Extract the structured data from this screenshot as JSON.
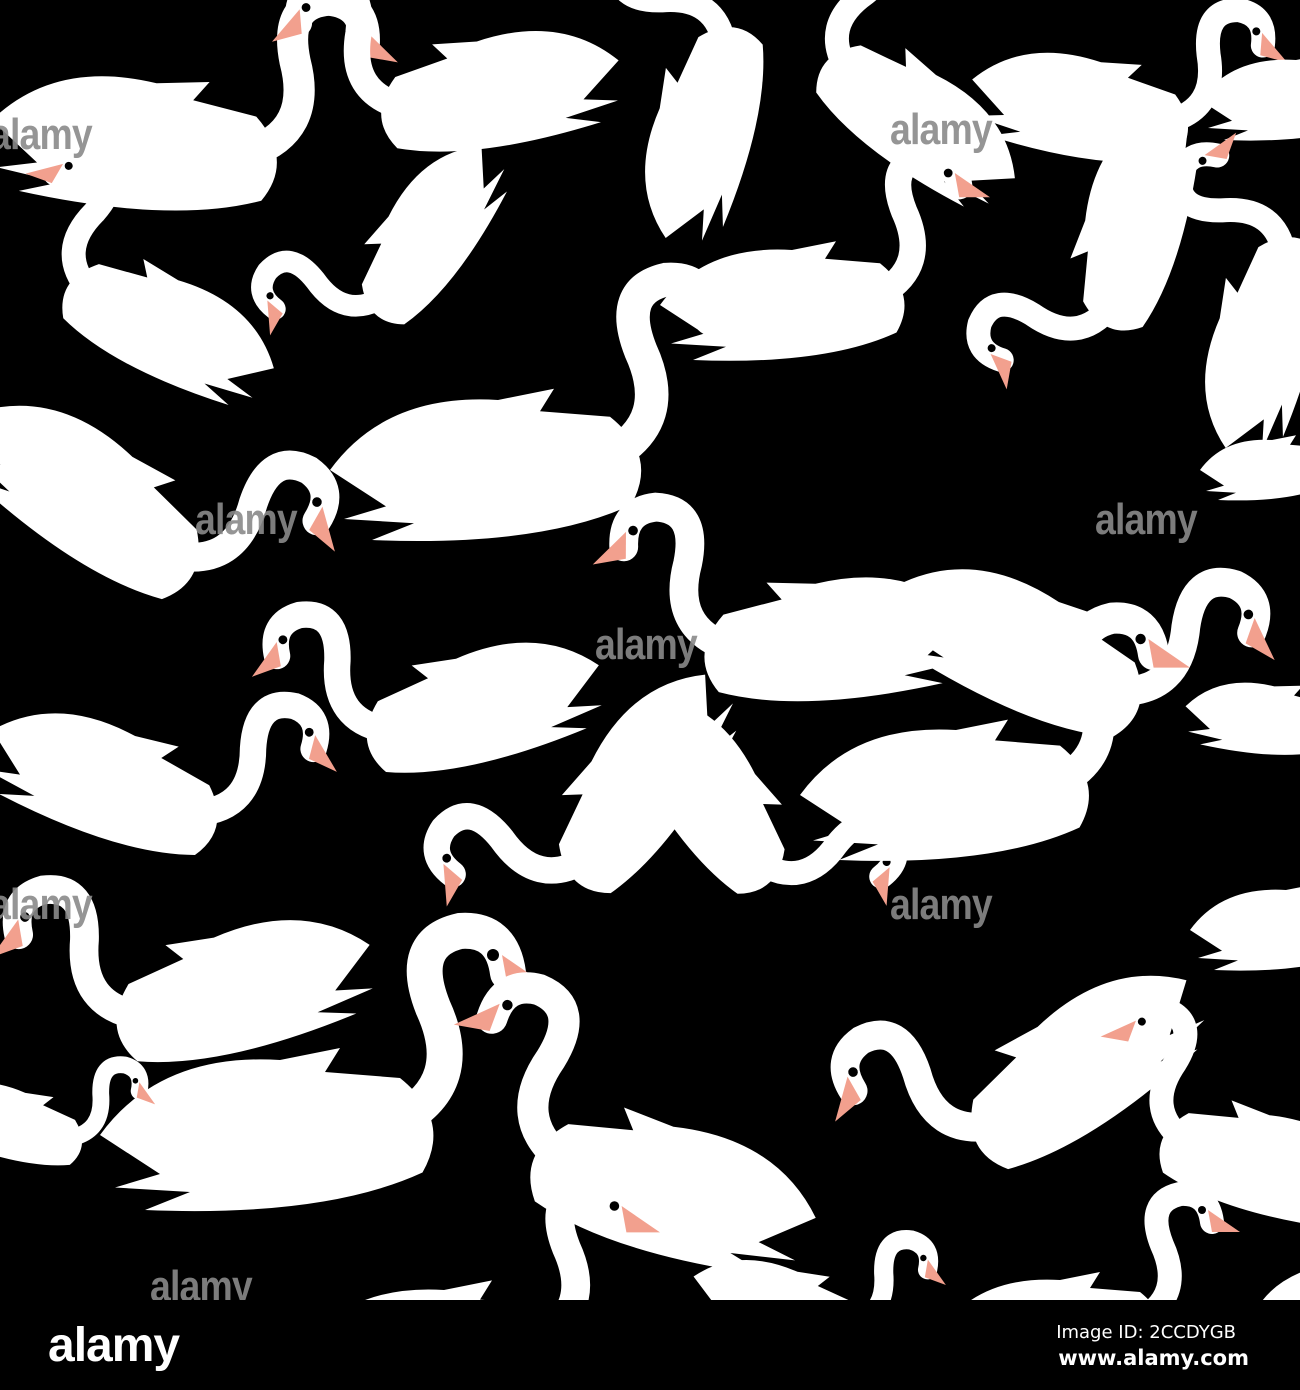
{
  "colors": {
    "background": "#000000",
    "swan": "#ffffff",
    "beak": "#f2a08e",
    "watermark": "#8a8a8a"
  },
  "watermark": {
    "text": "alamy"
  },
  "footer": {
    "logo": "alamy",
    "image_id": "Image ID: 2CCDYGB",
    "website": "www.alamy.com"
  }
}
